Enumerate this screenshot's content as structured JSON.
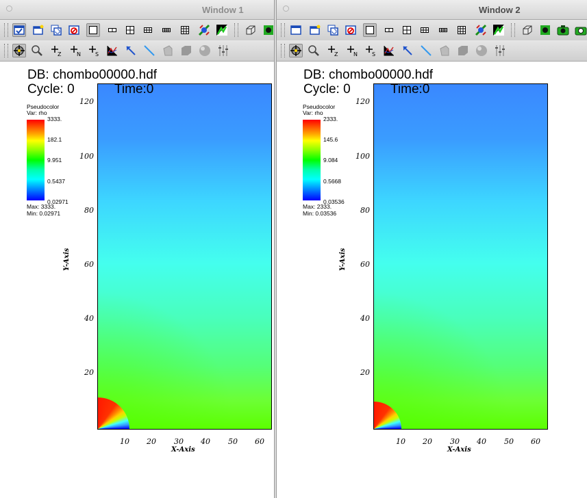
{
  "windows": [
    {
      "title": "Window 1",
      "db_label": "DB: chombo00000.hdf",
      "cycle_label": "Cycle: 0",
      "time_label": "Time:0",
      "legend": {
        "plot_type": "Pseudocolor",
        "var_label": "Var: rho",
        "ticks": [
          "3333.",
          "182.1",
          "9.951",
          "0.5437",
          "0.02971"
        ],
        "max_label": "Max:  3333.",
        "min_label": "Min:  0.02971"
      }
    },
    {
      "title": "Window 2",
      "db_label": "DB: chombo00000.hdf",
      "cycle_label": "Cycle: 0",
      "time_label": "Time:0",
      "legend": {
        "plot_type": "Pseudocolor",
        "var_label": "Var: rho",
        "ticks": [
          "2333.",
          "145.6",
          "9.084",
          "0.5668",
          "0.03536"
        ],
        "max_label": "Max:  2333.",
        "min_label": "Min:  0.03536"
      }
    }
  ],
  "axes": {
    "x_label": "X-Axis",
    "y_label": "Y-Axis",
    "x_ticks": [
      "10",
      "20",
      "30",
      "40",
      "50",
      "60"
    ],
    "y_ticks": [
      "20",
      "40",
      "60",
      "80",
      "100",
      "120"
    ]
  },
  "toolbar_icons": {
    "row1": [
      "active-window-icon",
      "new-window-icon",
      "clone-window-icon",
      "delete-window-icon",
      "layout-1x1-icon",
      "layout-1x2-icon",
      "layout-2x2-icon",
      "layout-2x3-icon",
      "layout-2x4-icon",
      "layout-3x3-icon",
      "spin-mode-icon",
      "invert-background-icon",
      "view-3d-icon",
      "lock-view-icon",
      "camera-icon",
      "snapshot-icon"
    ],
    "row2": [
      "navigate-mode-icon",
      "zoom-mode-icon",
      "zone-pick-icon",
      "node-pick-icon",
      "spreadsheet-pick-icon",
      "lineout-icon",
      "point-tool-icon",
      "line-tool-icon",
      "plane-tool-icon",
      "box-tool-icon",
      "sphere-tool-icon",
      "axis-restriction-icon"
    ]
  },
  "colors": {
    "colorbar_top": "#ff0000",
    "colorbar_bottom": "#0000ff"
  }
}
